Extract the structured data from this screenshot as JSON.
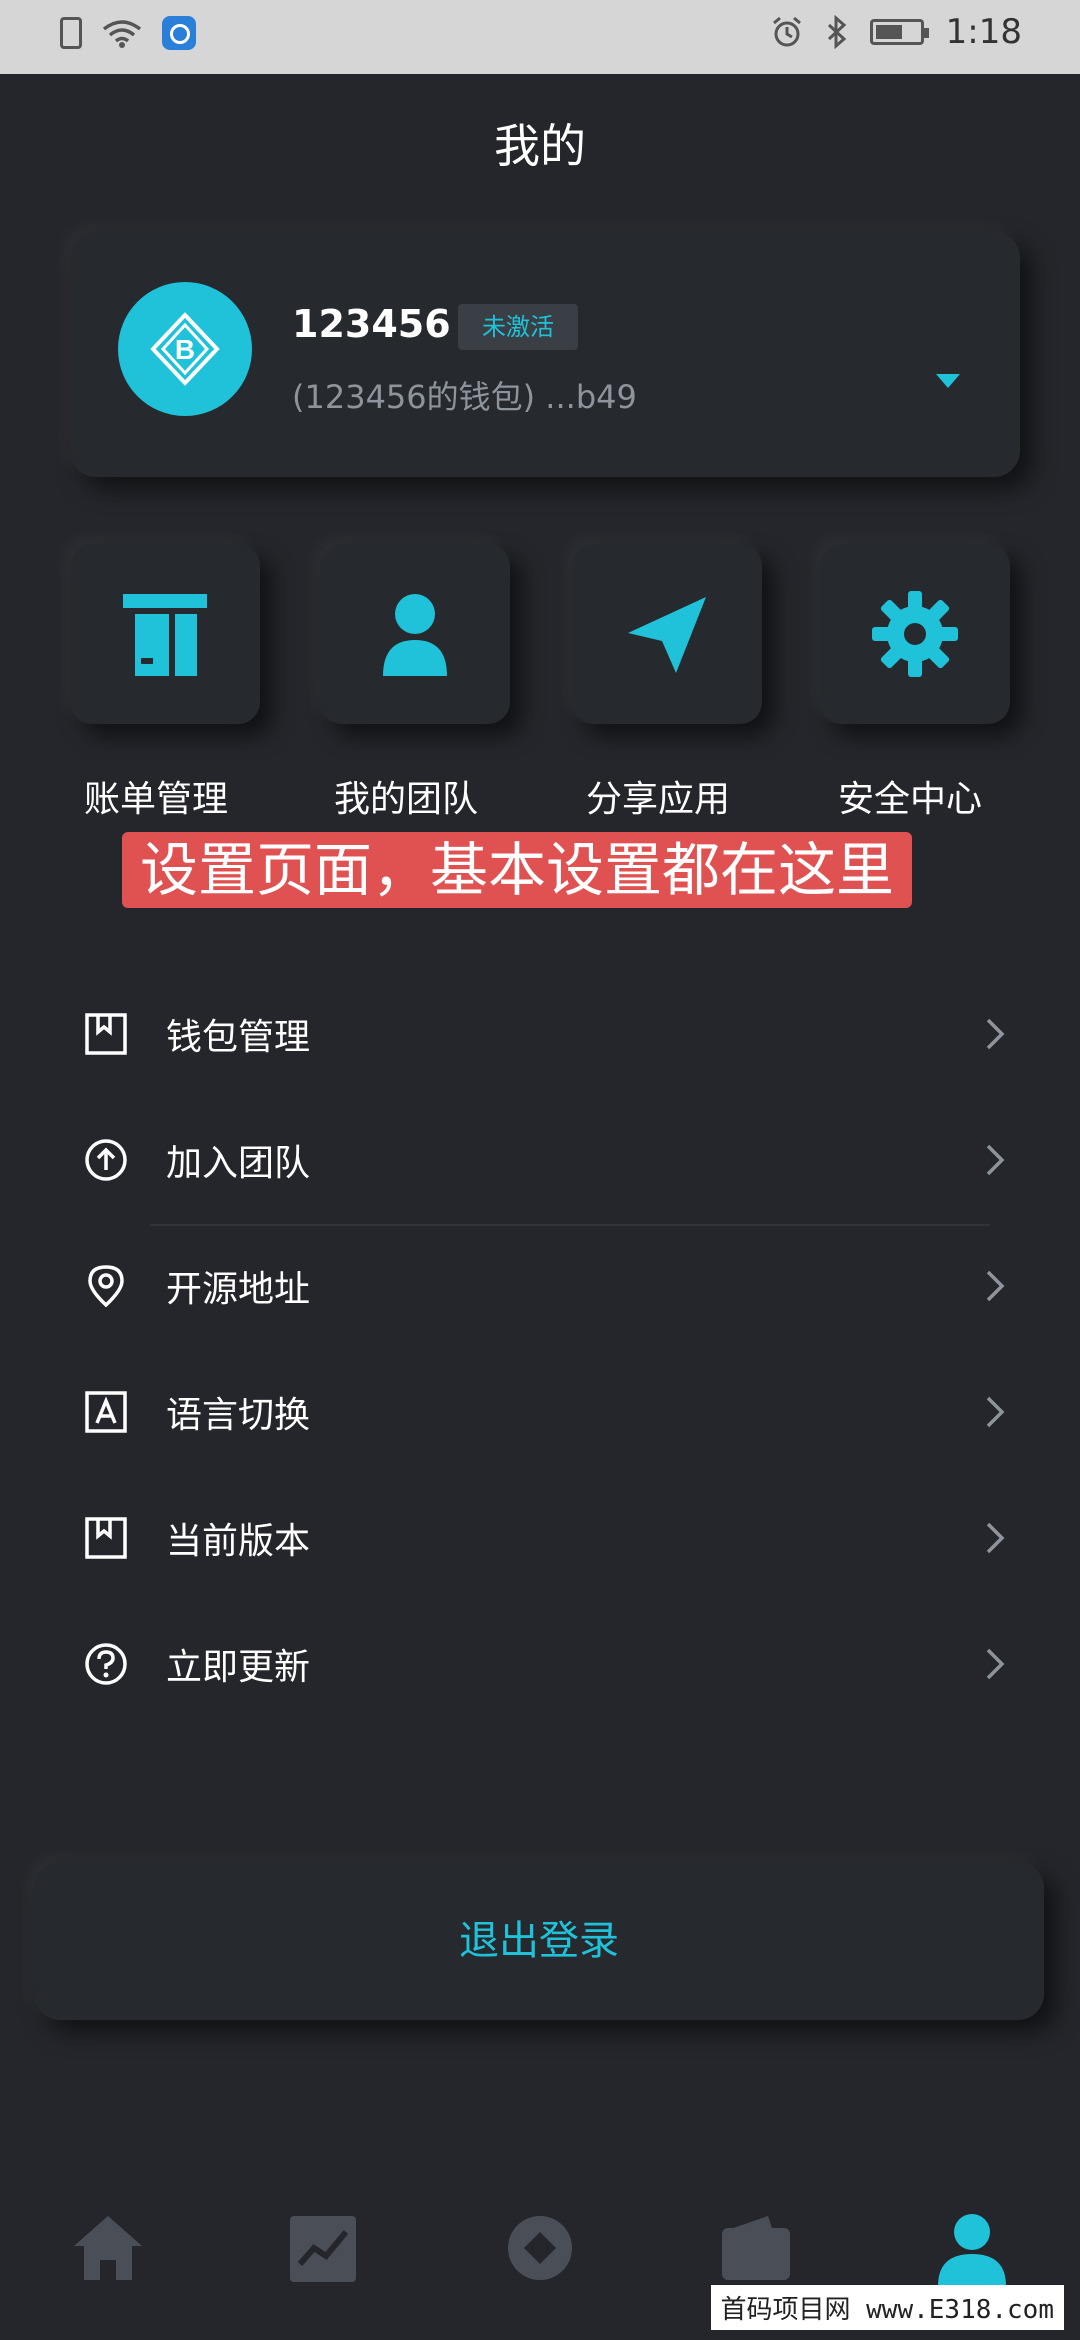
{
  "status_bar": {
    "time": "1:18"
  },
  "header": {
    "title": "我的"
  },
  "profile": {
    "username": "123456",
    "status_badge": "未激活",
    "wallet_line": "(123456的钱包) ...b49"
  },
  "quick_actions": [
    {
      "label": "账单管理",
      "icon": "bill-icon"
    },
    {
      "label": "我的团队",
      "icon": "user-icon"
    },
    {
      "label": "分享应用",
      "icon": "send-icon"
    },
    {
      "label": "安全中心",
      "icon": "gear-icon"
    }
  ],
  "annotation": {
    "text": "设置页面，基本设置都在这里"
  },
  "menu": [
    {
      "label": "钱包管理",
      "icon": "bookmark-icon"
    },
    {
      "label": "加入团队",
      "icon": "arrow-up-circle-icon"
    },
    {
      "label": "开源地址",
      "icon": "location-pin-icon"
    },
    {
      "label": "语言切换",
      "icon": "language-icon"
    },
    {
      "label": "当前版本",
      "icon": "bookmark-icon"
    },
    {
      "label": "立即更新",
      "icon": "question-circle-icon"
    }
  ],
  "logout": {
    "label": "退出登录"
  },
  "tabs": [
    {
      "name": "home-tab",
      "icon": "home-icon"
    },
    {
      "name": "market-tab",
      "icon": "chart-icon"
    },
    {
      "name": "discover-tab",
      "icon": "compass-icon"
    },
    {
      "name": "wallet-tab",
      "icon": "wallet-icon"
    },
    {
      "name": "profile-tab",
      "icon": "profile-icon",
      "active": true
    }
  ],
  "colors": {
    "accent": "#1fc2d8",
    "background": "#24262b",
    "card": "#262a2f",
    "annotation": "#e05252"
  },
  "watermark": {
    "text": "首码项目网 www.E318.com"
  }
}
